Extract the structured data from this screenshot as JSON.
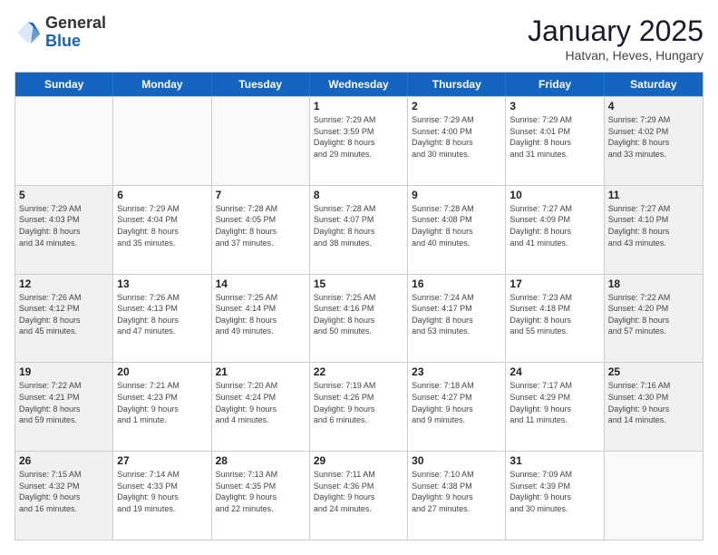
{
  "header": {
    "logo": {
      "general": "General",
      "blue": "Blue"
    },
    "title": "January 2025",
    "location": "Hatvan, Heves, Hungary"
  },
  "dayHeaders": [
    "Sunday",
    "Monday",
    "Tuesday",
    "Wednesday",
    "Thursday",
    "Friday",
    "Saturday"
  ],
  "weeks": [
    [
      {
        "day": "",
        "info": ""
      },
      {
        "day": "",
        "info": ""
      },
      {
        "day": "",
        "info": ""
      },
      {
        "day": "1",
        "info": "Sunrise: 7:29 AM\nSunset: 3:59 PM\nDaylight: 8 hours\nand 29 minutes."
      },
      {
        "day": "2",
        "info": "Sunrise: 7:29 AM\nSunset: 4:00 PM\nDaylight: 8 hours\nand 30 minutes."
      },
      {
        "day": "3",
        "info": "Sunrise: 7:29 AM\nSunset: 4:01 PM\nDaylight: 8 hours\nand 31 minutes."
      },
      {
        "day": "4",
        "info": "Sunrise: 7:29 AM\nSunset: 4:02 PM\nDaylight: 8 hours\nand 33 minutes."
      }
    ],
    [
      {
        "day": "5",
        "info": "Sunrise: 7:29 AM\nSunset: 4:03 PM\nDaylight: 8 hours\nand 34 minutes."
      },
      {
        "day": "6",
        "info": "Sunrise: 7:29 AM\nSunset: 4:04 PM\nDaylight: 8 hours\nand 35 minutes."
      },
      {
        "day": "7",
        "info": "Sunrise: 7:28 AM\nSunset: 4:05 PM\nDaylight: 8 hours\nand 37 minutes."
      },
      {
        "day": "8",
        "info": "Sunrise: 7:28 AM\nSunset: 4:07 PM\nDaylight: 8 hours\nand 38 minutes."
      },
      {
        "day": "9",
        "info": "Sunrise: 7:28 AM\nSunset: 4:08 PM\nDaylight: 8 hours\nand 40 minutes."
      },
      {
        "day": "10",
        "info": "Sunrise: 7:27 AM\nSunset: 4:09 PM\nDaylight: 8 hours\nand 41 minutes."
      },
      {
        "day": "11",
        "info": "Sunrise: 7:27 AM\nSunset: 4:10 PM\nDaylight: 8 hours\nand 43 minutes."
      }
    ],
    [
      {
        "day": "12",
        "info": "Sunrise: 7:26 AM\nSunset: 4:12 PM\nDaylight: 8 hours\nand 45 minutes."
      },
      {
        "day": "13",
        "info": "Sunrise: 7:26 AM\nSunset: 4:13 PM\nDaylight: 8 hours\nand 47 minutes."
      },
      {
        "day": "14",
        "info": "Sunrise: 7:25 AM\nSunset: 4:14 PM\nDaylight: 8 hours\nand 49 minutes."
      },
      {
        "day": "15",
        "info": "Sunrise: 7:25 AM\nSunset: 4:16 PM\nDaylight: 8 hours\nand 50 minutes."
      },
      {
        "day": "16",
        "info": "Sunrise: 7:24 AM\nSunset: 4:17 PM\nDaylight: 8 hours\nand 53 minutes."
      },
      {
        "day": "17",
        "info": "Sunrise: 7:23 AM\nSunset: 4:18 PM\nDaylight: 8 hours\nand 55 minutes."
      },
      {
        "day": "18",
        "info": "Sunrise: 7:22 AM\nSunset: 4:20 PM\nDaylight: 8 hours\nand 57 minutes."
      }
    ],
    [
      {
        "day": "19",
        "info": "Sunrise: 7:22 AM\nSunset: 4:21 PM\nDaylight: 8 hours\nand 59 minutes."
      },
      {
        "day": "20",
        "info": "Sunrise: 7:21 AM\nSunset: 4:23 PM\nDaylight: 9 hours\nand 1 minute."
      },
      {
        "day": "21",
        "info": "Sunrise: 7:20 AM\nSunset: 4:24 PM\nDaylight: 9 hours\nand 4 minutes."
      },
      {
        "day": "22",
        "info": "Sunrise: 7:19 AM\nSunset: 4:26 PM\nDaylight: 9 hours\nand 6 minutes."
      },
      {
        "day": "23",
        "info": "Sunrise: 7:18 AM\nSunset: 4:27 PM\nDaylight: 9 hours\nand 9 minutes."
      },
      {
        "day": "24",
        "info": "Sunrise: 7:17 AM\nSunset: 4:29 PM\nDaylight: 9 hours\nand 11 minutes."
      },
      {
        "day": "25",
        "info": "Sunrise: 7:16 AM\nSunset: 4:30 PM\nDaylight: 9 hours\nand 14 minutes."
      }
    ],
    [
      {
        "day": "26",
        "info": "Sunrise: 7:15 AM\nSunset: 4:32 PM\nDaylight: 9 hours\nand 16 minutes."
      },
      {
        "day": "27",
        "info": "Sunrise: 7:14 AM\nSunset: 4:33 PM\nDaylight: 9 hours\nand 19 minutes."
      },
      {
        "day": "28",
        "info": "Sunrise: 7:13 AM\nSunset: 4:35 PM\nDaylight: 9 hours\nand 22 minutes."
      },
      {
        "day": "29",
        "info": "Sunrise: 7:11 AM\nSunset: 4:36 PM\nDaylight: 9 hours\nand 24 minutes."
      },
      {
        "day": "30",
        "info": "Sunrise: 7:10 AM\nSunset: 4:38 PM\nDaylight: 9 hours\nand 27 minutes."
      },
      {
        "day": "31",
        "info": "Sunrise: 7:09 AM\nSunset: 4:39 PM\nDaylight: 9 hours\nand 30 minutes."
      },
      {
        "day": "",
        "info": ""
      }
    ]
  ]
}
